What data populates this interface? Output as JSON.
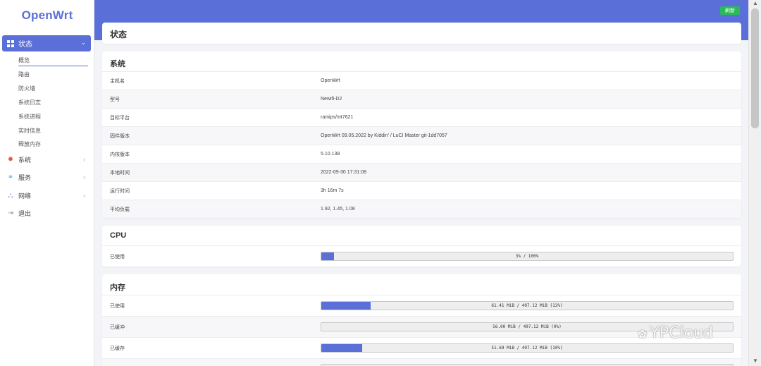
{
  "sidebar": {
    "logo": "OpenWrt",
    "active": {
      "label": "状态"
    },
    "subitems": [
      "概览",
      "路由",
      "防火墙",
      "系统日志",
      "系统进程",
      "实时信息",
      "释放内存"
    ],
    "items": [
      {
        "label": "系统",
        "icon": "gear-icon"
      },
      {
        "label": "服务",
        "icon": "link-icon"
      },
      {
        "label": "网络",
        "icon": "network-icon"
      },
      {
        "label": "退出",
        "icon": "logout-icon"
      }
    ]
  },
  "header": {
    "refresh_label": "刷新"
  },
  "page": {
    "title": "状态"
  },
  "system": {
    "title": "系统",
    "rows": [
      {
        "key": "主机名",
        "value": "OpenWrt"
      },
      {
        "key": "型号",
        "value": "Newifi-D2"
      },
      {
        "key": "目标平台",
        "value": "ramips/mt7621"
      },
      {
        "key": "固件版本",
        "value": "OpenWrt 09.05.2022 by Kiddin' / LuCI Master git-1dd7057"
      },
      {
        "key": "内核版本",
        "value": "5.10.138"
      },
      {
        "key": "本地时间",
        "value": "2022-09-30 17:31:08"
      },
      {
        "key": "运行时间",
        "value": "3h 16m 7s"
      },
      {
        "key": "平均负载",
        "value": "1.92, 1.45, 1.08"
      }
    ]
  },
  "cpu": {
    "title": "CPU",
    "rows": [
      {
        "key": "已使用",
        "text": "3% / 100%",
        "percent": 3
      }
    ]
  },
  "memory": {
    "title": "内存",
    "rows": [
      {
        "key": "已使用",
        "text": "61.41 MiB / 497.12 MiB (12%)",
        "percent": 12
      },
      {
        "key": "已缓冲",
        "text": "56.00 MiB / 497.12 MiB (0%)",
        "percent": 0
      },
      {
        "key": "已缓存",
        "text": "51.69 MiB / 497.12 MiB (10%)",
        "percent": 10
      }
    ]
  },
  "watermark": "YPCloud",
  "colors": {
    "accent": "#5b6fd8",
    "refresh": "#2bba5a"
  }
}
